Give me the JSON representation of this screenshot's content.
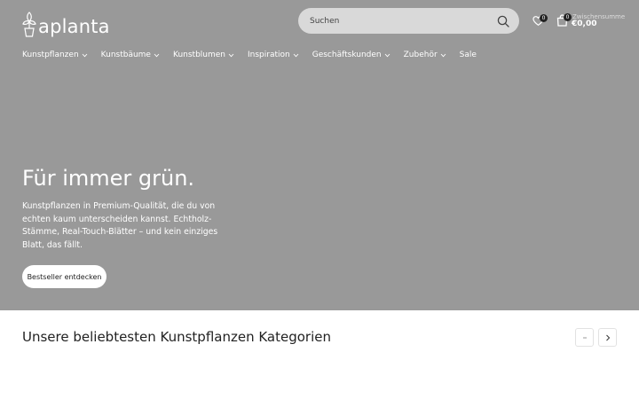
{
  "header": {
    "logo_text": "aplanta",
    "search": {
      "placeholder": "Suchen"
    },
    "wishlist": {
      "count": "0"
    },
    "cart": {
      "count": "0",
      "label": "Zwischensumme",
      "total": "€0,00"
    }
  },
  "nav": {
    "items": [
      {
        "label": "Kunstpflanzen",
        "has_dropdown": true
      },
      {
        "label": "Kunstbäume",
        "has_dropdown": true
      },
      {
        "label": "Kunstblumen",
        "has_dropdown": true
      },
      {
        "label": "Inspiration",
        "has_dropdown": true
      },
      {
        "label": "Geschäftskunden",
        "has_dropdown": true
      },
      {
        "label": "Zubehör",
        "has_dropdown": true
      },
      {
        "label": "Sale",
        "has_dropdown": false
      }
    ]
  },
  "hero": {
    "title": "Für immer grün.",
    "text": "Kunstpflanzen in Premium-Qualität, die du von echten kaum unterscheiden kannst. Echtholz-Stämme, Real-Touch-Blätter – und kein einziges Blatt, das fällt.",
    "button_label": "Bestseller entdecken"
  },
  "categories": {
    "title": "Unsere beliebtesten Kunstpflanzen Kategorien"
  },
  "colors": {
    "hero_bg": "#999999",
    "search_bg": "#d9d9d9",
    "text_dark": "#222222",
    "white": "#ffffff"
  },
  "icons": [
    "plant-logo-icon",
    "search-icon",
    "heart-icon",
    "shopping-bag-icon",
    "chevron-down-icon",
    "chevron-left-icon",
    "chevron-right-icon"
  ]
}
